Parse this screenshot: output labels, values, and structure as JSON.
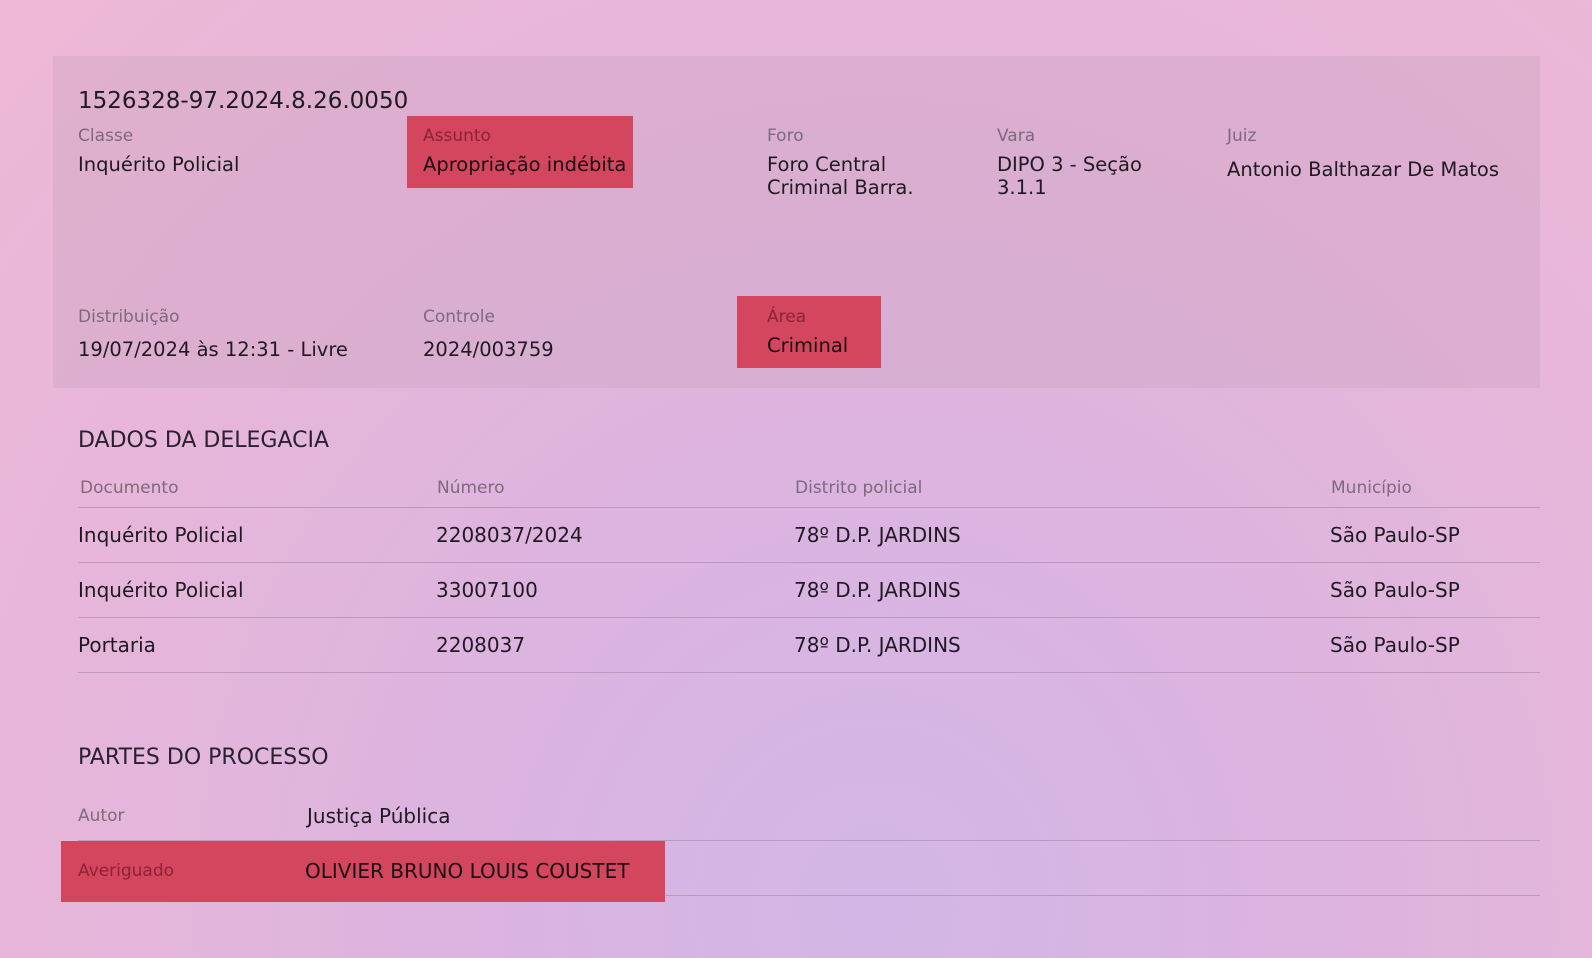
{
  "processo": {
    "numero": "1526328-97.2024.8.26.0050",
    "classe": {
      "label": "Classe",
      "value": "Inquérito Policial"
    },
    "assunto": {
      "label": "Assunto",
      "value": "Apropriação indébita"
    },
    "foro": {
      "label": "Foro",
      "line1": "Foro Central",
      "line2": "Criminal Barra."
    },
    "vara": {
      "label": "Vara",
      "line1": "DIPO 3 - Seção",
      "line2": "3.1.1"
    },
    "juiz": {
      "label": "Juiz",
      "value": "Antonio Balthazar De Matos"
    },
    "distribuicao": {
      "label": "Distribuição",
      "value": "19/07/2024 às 12:31 - Livre"
    },
    "controle": {
      "label": "Controle",
      "value": "2024/003759"
    },
    "area": {
      "label": "Área",
      "value": "Criminal"
    }
  },
  "delegacia": {
    "title": "DADOS DA DELEGACIA",
    "headers": [
      "Documento",
      "Número",
      "Distrito policial",
      "Município"
    ],
    "rows": [
      [
        "Inquérito Policial",
        "2208037/2024",
        "78º D.P. JARDINS",
        "São Paulo-SP"
      ],
      [
        "Inquérito Policial",
        "33007100",
        "78º D.P. JARDINS",
        "São Paulo-SP"
      ],
      [
        "Portaria",
        "2208037",
        "78º D.P. JARDINS",
        "São Paulo-SP"
      ]
    ]
  },
  "partes": {
    "title": "PARTES DO PROCESSO",
    "items": [
      {
        "role": "Autor",
        "name": "Justiça Pública"
      },
      {
        "role": "Averiguado",
        "name": "OLIVIER BRUNO LOUIS COUSTET"
      }
    ]
  },
  "colors": {
    "highlight": "#d4455e"
  }
}
